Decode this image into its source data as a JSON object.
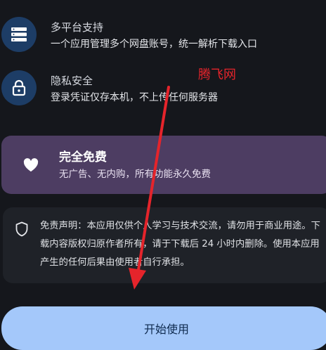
{
  "features": [
    {
      "title": "多平台支持",
      "description": "一个应用管理多个网盘账号，统一解析下载入口",
      "icon": "server-icon"
    },
    {
      "title": "隐私安全",
      "description": "登录凭证仅存本机，不上传任何服务器",
      "icon": "lock-icon"
    }
  ],
  "watermark": "腾飞网",
  "free_card": {
    "title": "完全免费",
    "description": "无广告、无内购，所有功能永久免费",
    "icon": "heart-icon",
    "background": "#4d3d62"
  },
  "disclaimer": {
    "text": "免责声明：本应用仅供个人学习与技术交流，请勿用于商业用途。下载内容版权归原作者所有，请于下载后 24 小时内删除。使用本应用产生的任何后果由使用者自行承担。",
    "icon": "shield-icon"
  },
  "start_button": {
    "label": "开始使用",
    "background": "#a4c8fa"
  },
  "colors": {
    "background": "#15171c",
    "icon_circle": "#1d3d66",
    "watermark": "#e5242b"
  }
}
